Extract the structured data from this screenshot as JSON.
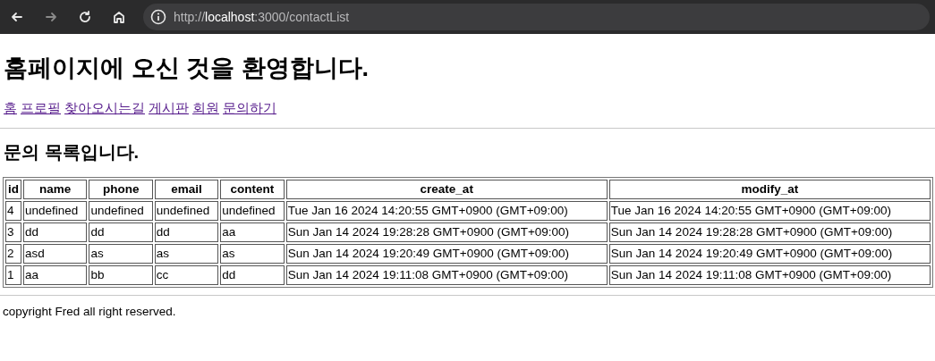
{
  "browser": {
    "url_prefix": "http://",
    "url_host": "localhost",
    "url_rest": ":3000/contactList"
  },
  "title": "홈페이지에 오신 것을 환영합니다.",
  "nav_links": [
    "홈",
    "프로필",
    "찾아오시는길",
    "게시판",
    "회원",
    "문의하기"
  ],
  "heading": "문의 목록입니다.",
  "table": {
    "columns": [
      "id",
      "name",
      "phone",
      "email",
      "content",
      "create_at",
      "modify_at"
    ],
    "rows": [
      [
        "4",
        "undefined",
        "undefined",
        "undefined",
        "undefined",
        "Tue Jan 16 2024 14:20:55 GMT+0900 (GMT+09:00)",
        "Tue Jan 16 2024 14:20:55 GMT+0900 (GMT+09:00)"
      ],
      [
        "3",
        "dd",
        "dd",
        "dd",
        "aa",
        "Sun Jan 14 2024 19:28:28 GMT+0900 (GMT+09:00)",
        "Sun Jan 14 2024 19:28:28 GMT+0900 (GMT+09:00)"
      ],
      [
        "2",
        "asd",
        "as",
        "as",
        "as",
        "Sun Jan 14 2024 19:20:49 GMT+0900 (GMT+09:00)",
        "Sun Jan 14 2024 19:20:49 GMT+0900 (GMT+09:00)"
      ],
      [
        "1",
        "aa",
        "bb",
        "cc",
        "dd",
        "Sun Jan 14 2024 19:11:08 GMT+0900 (GMT+09:00)",
        "Sun Jan 14 2024 19:11:08 GMT+0900 (GMT+09:00)"
      ]
    ]
  },
  "footer": "copyright Fred all right reserved."
}
